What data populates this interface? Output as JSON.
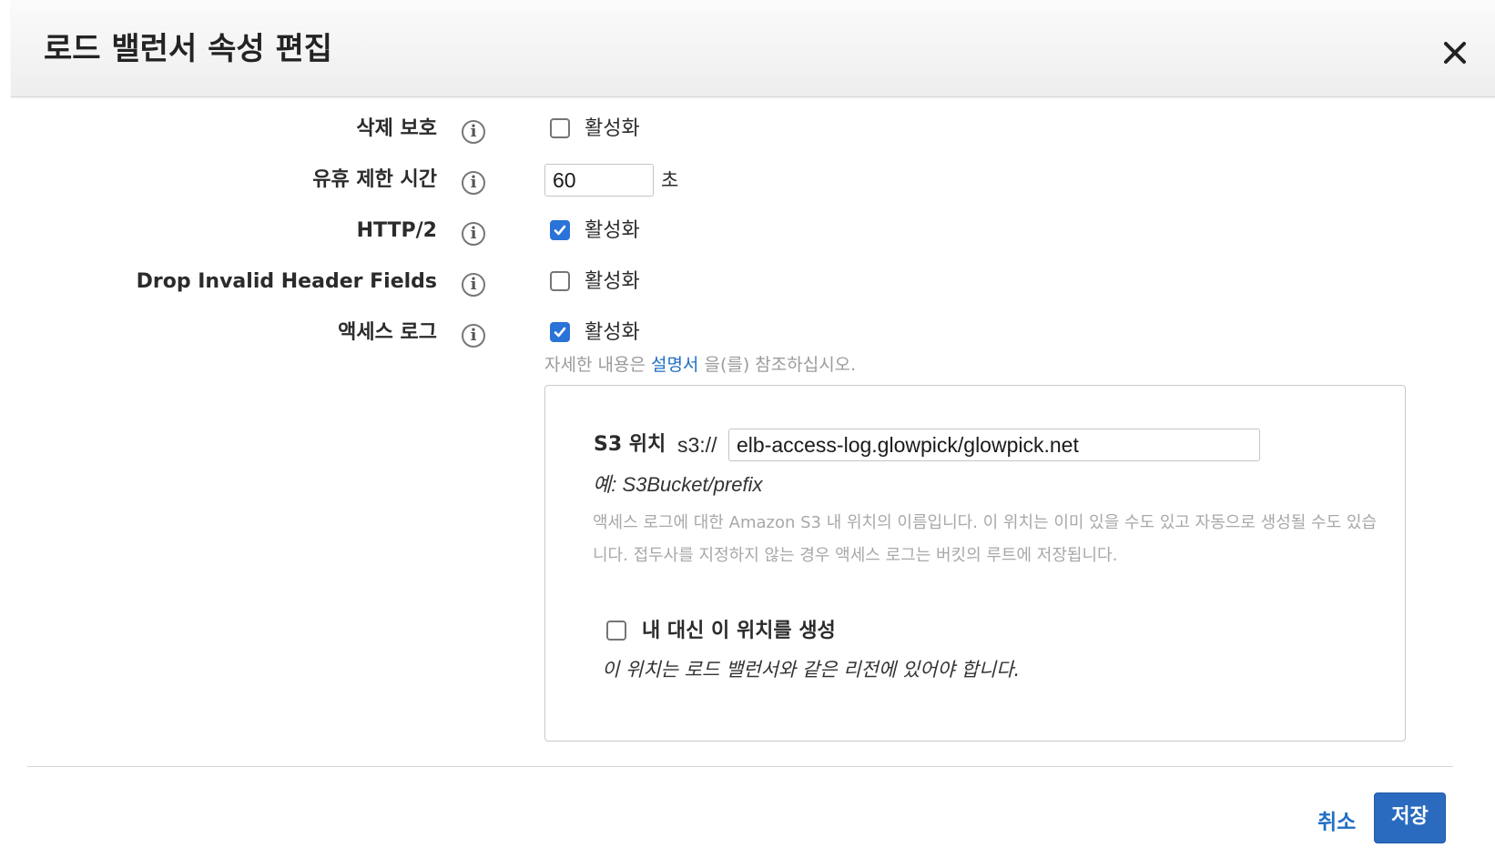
{
  "modal": {
    "title": "로드 밸런서 속성 편집",
    "close_icon": "close-icon"
  },
  "rows": {
    "deletion_protection": {
      "label": "삭제 보호",
      "checkbox_label": "활성화",
      "checked": false
    },
    "idle_timeout": {
      "label": "유휴 제한 시간",
      "value": "60",
      "unit": "초"
    },
    "http2": {
      "label": "HTTP/2",
      "checkbox_label": "활성화",
      "checked": true
    },
    "drop_invalid_header_fields": {
      "label": "Drop Invalid Header Fields",
      "checkbox_label": "활성화",
      "checked": false
    },
    "access_logs": {
      "label": "액세스 로그",
      "checkbox_label": "활성화",
      "checked": true,
      "help_prefix": "자세한 내용은 ",
      "help_link": "설명서",
      "help_suffix": " 을(를) 참조하십시오."
    }
  },
  "s3": {
    "label": "S3 위치",
    "prefix": "s3://",
    "value": "elb-access-log.glowpick/glowpick.net",
    "example": "예: S3Bucket/prefix",
    "description": "액세스 로그에 대한 Amazon S3 내 위치의 이름입니다. 이 위치는 이미 있을 수도 있고 자동으로 생성될 수도 있습니다. 접두사를 지정하지 않는 경우 액세스 로그는 버킷의 루트에 저장됩니다.",
    "create_checkbox_label": "내 대신 이 위치를 생성",
    "create_checked": false,
    "region_note": "이 위치는 로드 밸런서와 같은 리전에 있어야 합니다."
  },
  "footer": {
    "cancel_label": "취소",
    "save_label": "저장"
  },
  "icons": {
    "info": "info-icon",
    "checkmark": "checkmark-icon"
  },
  "colors": {
    "primary": "#2a6bbf",
    "link": "#1f6fc5",
    "checkbox_checked": "#2a73d8"
  }
}
